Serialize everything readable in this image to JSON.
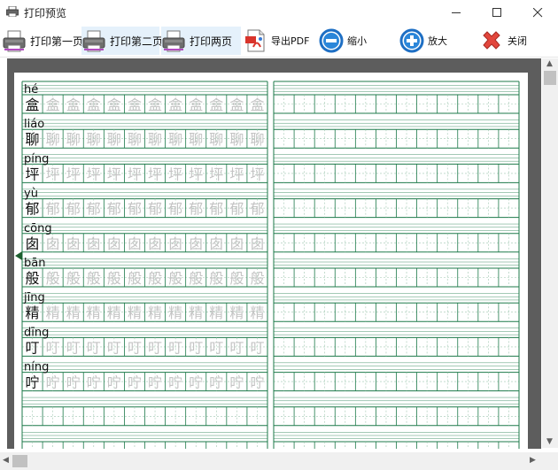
{
  "window": {
    "title": "打印预览"
  },
  "toolbar": {
    "print_first": "打印第一页",
    "print_second": "打印第二页",
    "print_both": "打印两页",
    "export_pdf": "导出PDF",
    "zoom_out": "缩小",
    "zoom_in": "放大",
    "close": "关闭"
  },
  "colors": {
    "grid": "#1d7a4a",
    "dashed": "#9fc7b0",
    "trace": "#c4c4c4",
    "frame": "#5d5d5d"
  },
  "worksheet": {
    "rows": [
      {
        "pinyin": "hé",
        "char": "盒"
      },
      {
        "pinyin": "liáo",
        "char": "聊"
      },
      {
        "pinyin": "píng",
        "char": "坪"
      },
      {
        "pinyin": "yù",
        "char": "郁"
      },
      {
        "pinyin": "cōng",
        "char": "囱"
      },
      {
        "pinyin": "bān",
        "char": "般"
      },
      {
        "pinyin": "jīng",
        "char": "精"
      },
      {
        "pinyin": "dīng",
        "char": "叮"
      },
      {
        "pinyin": "níng",
        "char": "咛"
      }
    ]
  }
}
